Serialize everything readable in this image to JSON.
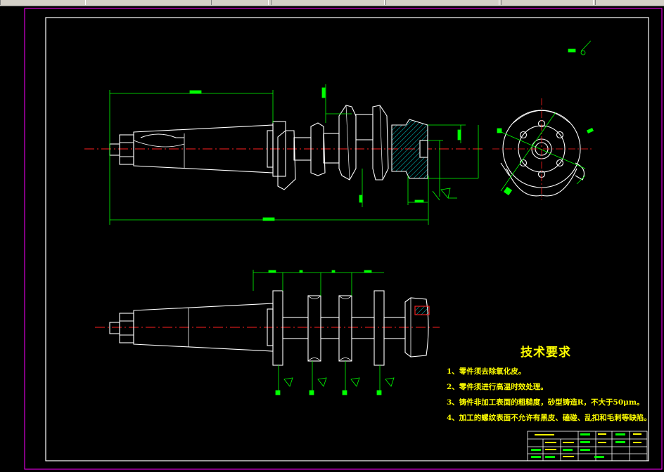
{
  "colors": {
    "background": "#000000",
    "outline": "#ffffff",
    "center_line": "#ff2020",
    "dimension": "#00ff00",
    "hatch": "#00ffff",
    "text": "#ffff00",
    "frame": "#ffffff",
    "sheet_border": "#ff00ff"
  },
  "technical_requirements": {
    "title": "技术要求",
    "items": [
      "1、零件须去除氧化皮。",
      "2、零件须进行高温时效处理。",
      "3、铸件非加工表面的粗糙度，砂型铸造R，不大于50μm。",
      "4、加工的螺纹表面不允许有黑皮、磕碰、乱扣和毛刺等缺陷。"
    ]
  },
  "toolbar": {
    "icons": [
      "toolbar-icon",
      "toolbar-icon",
      "toolbar-icon",
      "toolbar-icon"
    ]
  }
}
